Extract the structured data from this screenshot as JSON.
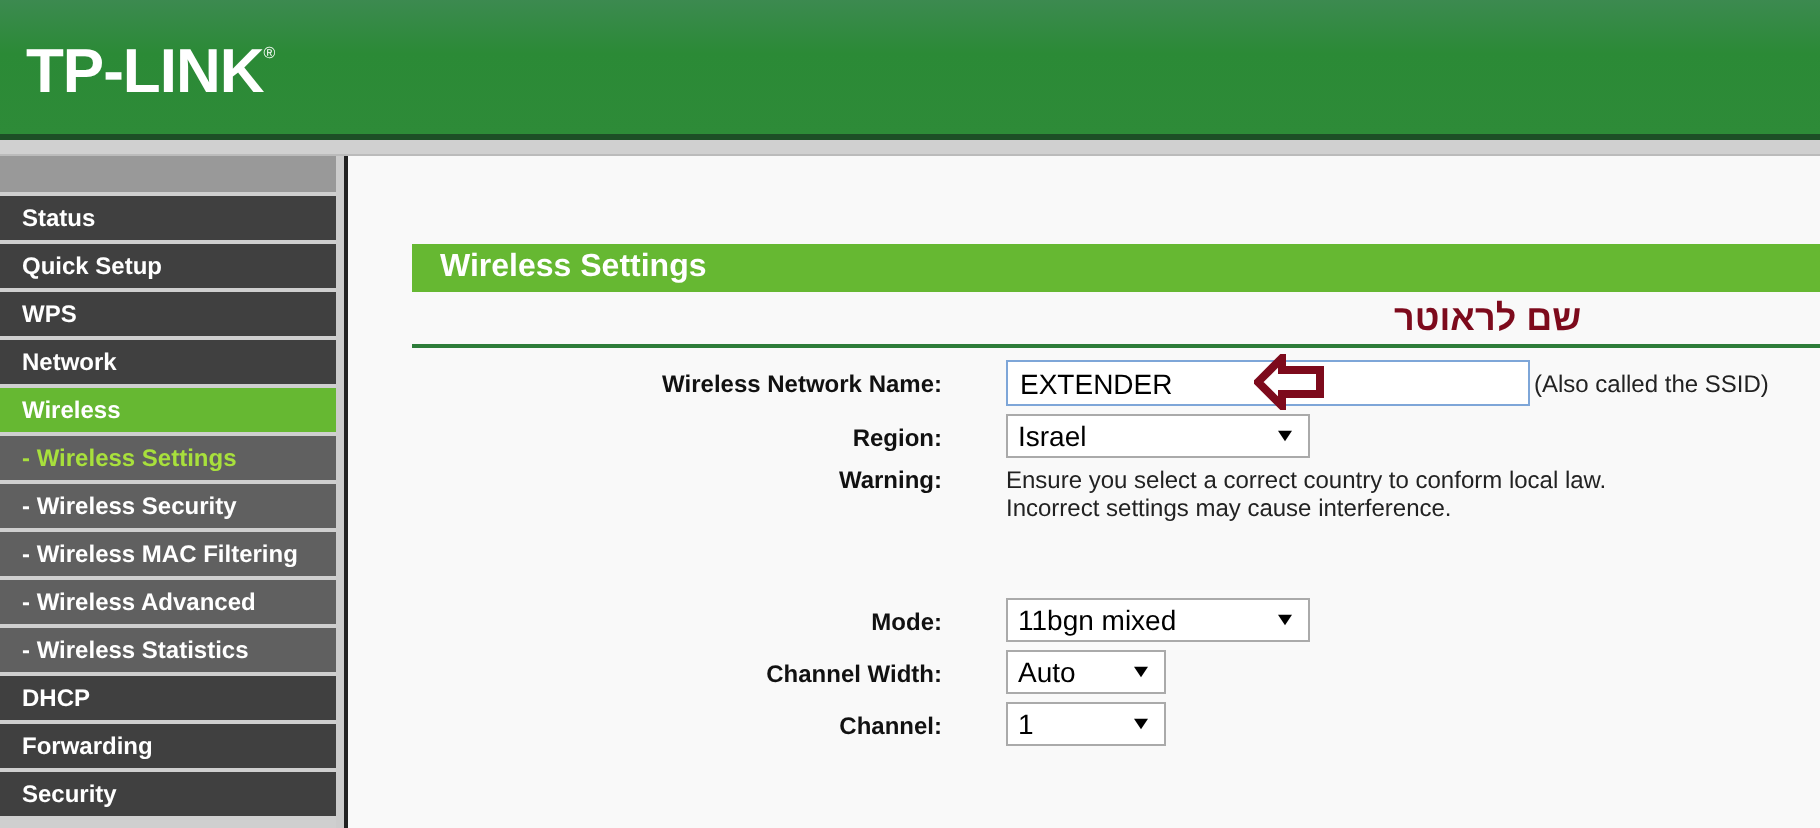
{
  "header": {
    "logo": "TP-LINK",
    "registered_mark": "®"
  },
  "sidebar": {
    "items": [
      {
        "label": "Status",
        "kind": "section",
        "selected": false
      },
      {
        "label": "Quick Setup",
        "kind": "section",
        "selected": false
      },
      {
        "label": "WPS",
        "kind": "section",
        "selected": false
      },
      {
        "label": "Network",
        "kind": "section",
        "selected": false
      },
      {
        "label": "Wireless",
        "kind": "section",
        "selected": true
      },
      {
        "label": "- Wireless Settings",
        "kind": "sub",
        "selected": true
      },
      {
        "label": "- Wireless Security",
        "kind": "sub",
        "selected": false
      },
      {
        "label": "- Wireless MAC Filtering",
        "kind": "sub",
        "selected": false
      },
      {
        "label": "- Wireless Advanced",
        "kind": "sub",
        "selected": false
      },
      {
        "label": "- Wireless Statistics",
        "kind": "sub",
        "selected": false
      },
      {
        "label": "DHCP",
        "kind": "section",
        "selected": false
      },
      {
        "label": "Forwarding",
        "kind": "section",
        "selected": false
      },
      {
        "label": "Security",
        "kind": "section",
        "selected": false
      }
    ]
  },
  "panel": {
    "title": "Wireless Settings",
    "annotation": "שם לראוטר",
    "fields": [
      {
        "label": "Wireless Network Name:",
        "kind": "text",
        "value": "EXTENDER",
        "note": "(Also called the SSID)"
      },
      {
        "label": "Region:",
        "kind": "select-wide",
        "value": "Israel"
      },
      {
        "label": "Warning:",
        "kind": "message",
        "lines": [
          "Ensure you select a correct country to conform local law.",
          "Incorrect settings may cause interference."
        ]
      },
      {
        "label": "Mode:",
        "kind": "select-wide",
        "value": "11bgn mixed"
      },
      {
        "label": "Channel Width:",
        "kind": "select-narrow",
        "value": "Auto"
      },
      {
        "label": "Channel:",
        "kind": "select-narrow",
        "value": "1"
      }
    ]
  }
}
